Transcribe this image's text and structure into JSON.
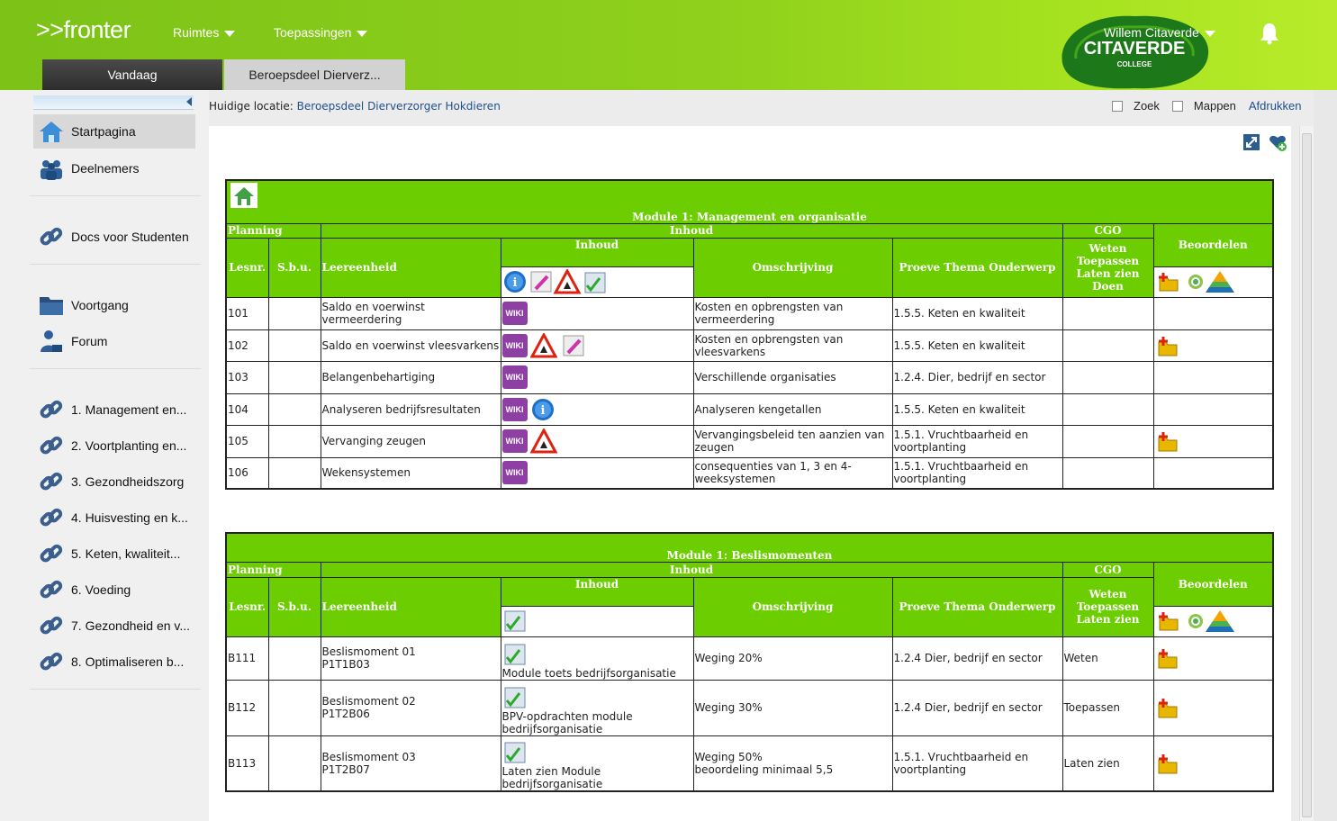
{
  "app": {
    "logo": ">>fronter",
    "menu": [
      {
        "label": "Ruimtes"
      },
      {
        "label": "Toepassingen"
      }
    ],
    "user": "Willem Citaverde",
    "brand_main": "CITAVERDE",
    "brand_sub": "COLLEGE"
  },
  "tabs": [
    {
      "label": "Vandaag"
    },
    {
      "label": "Beroepsdeel Dierverz..."
    }
  ],
  "sidebar": {
    "items": [
      {
        "label": "Startpagina",
        "icon": "home-icon"
      },
      {
        "label": "Deelnemers",
        "icon": "people-icon"
      },
      {
        "label": "Docs voor Studenten",
        "icon": "link-icon"
      },
      {
        "label": "Voortgang",
        "icon": "folder-icon"
      },
      {
        "label": "Forum",
        "icon": "forum-icon"
      },
      {
        "label": "1. Management en...",
        "icon": "link-icon"
      },
      {
        "label": "2. Voortplanting en...",
        "icon": "link-icon"
      },
      {
        "label": "3. Gezondheidszorg",
        "icon": "link-icon"
      },
      {
        "label": "4. Huisvesting en k...",
        "icon": "link-icon"
      },
      {
        "label": "5. Keten, kwaliteit...",
        "icon": "link-icon"
      },
      {
        "label": "6. Voeding",
        "icon": "link-icon"
      },
      {
        "label": "7. Gezondheid en v...",
        "icon": "link-icon"
      },
      {
        "label": "8. Optimaliseren b...",
        "icon": "link-icon"
      }
    ]
  },
  "location": {
    "label": "Huidige locatie:",
    "value": "Beroepsdeel Dierverzorger Hokdieren"
  },
  "options": {
    "zoek": "Zoek",
    "mappen": "Mappen",
    "print": "Afdrukken"
  },
  "module1": {
    "title": "Module 1:  Management en organisatie",
    "planning": "Planning",
    "inhoud": "Inhoud",
    "cgo": "CGO",
    "lesnr": "Lesnr.",
    "sbu": "S.b.u.",
    "leereenheid": "Leereenheid",
    "inhoud_sub": "Inhoud",
    "omschrijving": "Omschrijving",
    "proeve": "Proeve Thema Onderwerp",
    "cgo_levels": [
      "Weten",
      "Toepassen",
      "Laten zien",
      "Doen"
    ],
    "beoordelen": "Beoordelen",
    "wiki": "WIKI",
    "rows": [
      {
        "nr": "101",
        "leer": "Saldo en voerwinst vermeerdering",
        "icons": [
          "wiki"
        ],
        "omschr": "Kosten en opbrengsten van vermeerdering",
        "proeve": "1.5.5. Keten en kwaliteit",
        "beo": false
      },
      {
        "nr": "102",
        "leer": "Saldo en voerwinst vleesvarkens",
        "icons": [
          "wiki",
          "warn",
          "edit"
        ],
        "omschr": "Kosten en opbrengsten van vleesvarkens",
        "proeve": "1.5.5. Keten en kwaliteit",
        "beo": true
      },
      {
        "nr": "103",
        "leer": "Belangenbehartiging",
        "icons": [
          "wiki"
        ],
        "omschr": "Verschillende organisaties",
        "proeve": "1.2.4. Dier, bedrijf en sector",
        "beo": false
      },
      {
        "nr": "104",
        "leer": "Analyseren bedrijfsresultaten",
        "icons": [
          "wiki",
          "info"
        ],
        "omschr": "Analyseren kengetallen",
        "proeve": "1.5.5. Keten en kwaliteit",
        "beo": false
      },
      {
        "nr": "105",
        "leer": "Vervanging zeugen",
        "icons": [
          "wiki",
          "warn"
        ],
        "omschr": "Vervangingsbeleid ten aanzien van zeugen",
        "proeve": "1.5.1. Vruchtbaarheid en voortplanting",
        "beo": true
      },
      {
        "nr": "106",
        "leer": "Wekensystemen",
        "icons": [
          "wiki"
        ],
        "omschr": "consequenties van 1, 3 en 4-weeksystemen",
        "proeve": "1.5.1. Vruchtbaarheid en voortplanting",
        "beo": false
      }
    ]
  },
  "module2": {
    "title": "Module 1:  Beslismomenten",
    "planning": "Planning",
    "inhoud": "Inhoud",
    "cgo": "CGO",
    "lesnr": "Lesnr.",
    "sbu": "S.b.u.",
    "leereenheid": "Leereenheid",
    "inhoud_sub": "Inhoud",
    "omschrijving": "Omschrijving",
    "proeve": "Proeve Thema Onderwerp",
    "cgo_levels": [
      "Weten",
      "Toepassen",
      "Laten zien"
    ],
    "beoordelen": "Beoordelen",
    "rows": [
      {
        "nr": "B111",
        "leer1": "Beslismoment 01",
        "leer2": "P1T1B03",
        "inhoud": "Module toets bedrijfsorganisatie",
        "omschr1": "Weging 20%",
        "omschr2": "",
        "proeve": "1.2.4 Dier, bedrijf en sector",
        "cgo": "Weten"
      },
      {
        "nr": "B112",
        "leer1": "Beslismoment 02",
        "leer2": "P1T2B06",
        "inhoud": "BPV-opdrachten module bedrijfsorganisatie",
        "omschr1": "Weging 30%",
        "omschr2": "",
        "proeve": "1.2.4 Dier, bedrijf en sector",
        "cgo": "Toepassen"
      },
      {
        "nr": "B113",
        "leer1": "Beslismoment 03",
        "leer2": "P1T2B07",
        "inhoud": "Laten zien Module bedrijfsorganisatie",
        "omschr1": "Weging 50%",
        "omschr2": "beoordeling minimaal 5,5",
        "proeve": "1.5.1. Vruchtbaarheid en voortplanting",
        "cgo": "Laten zien"
      }
    ]
  }
}
